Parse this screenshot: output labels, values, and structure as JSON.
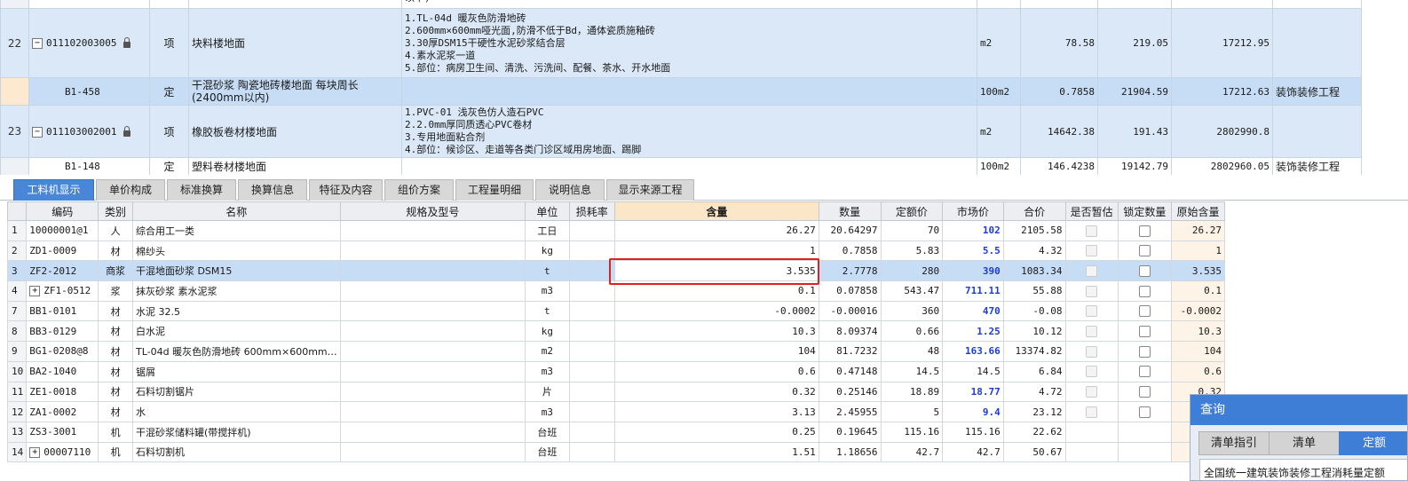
{
  "upper_rows": [
    {
      "kind": "partial",
      "feature": "以下)"
    },
    {
      "kind": "item",
      "num": "22",
      "code": "011102003005",
      "type": "项",
      "name": "块料楼地面",
      "features": [
        "1.TL-04d 暖灰色防滑地砖",
        "2.600mm×600mm哑光面,防滑不低于Bd，通体瓷质施釉砖",
        "3.30厚DSM15干硬性水泥砂浆结合层",
        "4.素水泥浆一道",
        "5.部位：病房卫生间、清洗、污洗间、配餐、茶水、开水地面"
      ],
      "unit": "m2",
      "qty": "78.58",
      "price": "219.05",
      "total": "17212.95",
      "profession": ""
    },
    {
      "kind": "sub",
      "num": "",
      "code": "B1-458",
      "type": "定",
      "name": "干混砂浆 陶瓷地砖楼地面 每块周长(2400mm以内)",
      "features": [],
      "unit": "100m2",
      "qty": "0.7858",
      "price": "21904.59",
      "total": "17212.63",
      "profession": "装饰装修工程"
    },
    {
      "kind": "item",
      "num": "23",
      "code": "011103002001",
      "type": "项",
      "name": "橡胶板卷材楼地面",
      "features": [
        "1.PVC-01 浅灰色仿人造石PVC",
        "2.2.0mm厚同质透心PVC卷材",
        "3.专用地面粘合剂",
        "4.部位：候诊区、走道等各类门诊区域用房地面、踢脚"
      ],
      "unit": "m2",
      "qty": "14642.38",
      "price": "191.43",
      "total": "2802990.8",
      "profession": ""
    },
    {
      "kind": "sub2",
      "num": "",
      "code": "B1-148",
      "type": "定",
      "name": "塑料卷材楼地面",
      "features": [],
      "unit": "100m2",
      "qty": "146.4238",
      "price": "19142.79",
      "total": "2802960.05",
      "profession": "装饰装修工程"
    }
  ],
  "tabs": [
    "工料机显示",
    "单价构成",
    "标准换算",
    "换算信息",
    "特征及内容",
    "组价方案",
    "工程量明细",
    "说明信息",
    "显示来源工程"
  ],
  "columns": [
    "编码",
    "类别",
    "名称",
    "规格及型号",
    "单位",
    "损耗率",
    "含量",
    "数量",
    "定额价",
    "市场价",
    "合价",
    "是否暂估",
    "锁定数量",
    "原始含量"
  ],
  "rows": [
    {
      "num": "1",
      "code": "10000001@1",
      "type": "人",
      "name": "综合用工一类",
      "spec": "",
      "unit": "工日",
      "loss": "",
      "content": "26.27",
      "qty": "20.64297",
      "quota": "70",
      "market": "102",
      "total": "2105.58",
      "est": false,
      "lock": true,
      "orig": "26.27",
      "exp": false
    },
    {
      "num": "2",
      "code": "ZD1-0009",
      "type": "材",
      "name": "棉纱头",
      "spec": "",
      "unit": "kg",
      "loss": "",
      "content": "1",
      "qty": "0.7858",
      "quota": "5.83",
      "market": "5.5",
      "total": "4.32",
      "est": false,
      "lock": true,
      "orig": "1",
      "exp": false
    },
    {
      "num": "3",
      "code": "ZF2-2012",
      "type": "商浆",
      "name": "干混地面砂浆 DSM15",
      "spec": "",
      "unit": "t",
      "loss": "",
      "content": "3.535",
      "qty": "2.7778",
      "quota": "280",
      "market": "390",
      "total": "1083.34",
      "est": false,
      "lock": true,
      "orig": "3.535",
      "exp": false,
      "selected": true
    },
    {
      "num": "4",
      "code": "ZF1-0512",
      "type": "浆",
      "name": "抹灰砂浆 素水泥浆",
      "spec": "",
      "unit": "m3",
      "loss": "",
      "content": "0.1",
      "qty": "0.07858",
      "quota": "543.47",
      "market": "711.11",
      "total": "55.88",
      "est": false,
      "lock": true,
      "orig": "0.1",
      "exp": true
    },
    {
      "num": "7",
      "code": "BB1-0101",
      "type": "材",
      "name": "水泥 32.5",
      "spec": "",
      "unit": "t",
      "loss": "",
      "content": "-0.0002",
      "qty": "-0.00016",
      "quota": "360",
      "market": "470",
      "total": "-0.08",
      "est": false,
      "lock": true,
      "orig": "-0.0002",
      "exp": false
    },
    {
      "num": "8",
      "code": "BB3-0129",
      "type": "材",
      "name": "白水泥",
      "spec": "",
      "unit": "kg",
      "loss": "",
      "content": "10.3",
      "qty": "8.09374",
      "quota": "0.66",
      "market": "1.25",
      "total": "10.12",
      "est": false,
      "lock": true,
      "orig": "10.3",
      "exp": false
    },
    {
      "num": "9",
      "code": "BG1-0208@8",
      "type": "材",
      "name": "TL-04d 暖灰色防滑地砖 600mm×600mm…",
      "spec": "",
      "unit": "m2",
      "loss": "",
      "content": "104",
      "qty": "81.7232",
      "quota": "48",
      "market": "163.66",
      "total": "13374.82",
      "est": false,
      "lock": true,
      "orig": "104",
      "exp": false
    },
    {
      "num": "10",
      "code": "BA2-1040",
      "type": "材",
      "name": "锯屑",
      "spec": "",
      "unit": "m3",
      "loss": "",
      "content": "0.6",
      "qty": "0.47148",
      "quota": "14.5",
      "market": "14.5",
      "total": "6.84",
      "est": false,
      "lock": true,
      "orig": "0.6",
      "exp": false
    },
    {
      "num": "11",
      "code": "ZE1-0018",
      "type": "材",
      "name": "石料切割锯片",
      "spec": "",
      "unit": "片",
      "loss": "",
      "content": "0.32",
      "qty": "0.25146",
      "quota": "18.89",
      "market": "18.77",
      "total": "4.72",
      "est": false,
      "lock": true,
      "orig": "0.32",
      "exp": false
    },
    {
      "num": "12",
      "code": "ZA1-0002",
      "type": "材",
      "name": "水",
      "spec": "",
      "unit": "m3",
      "loss": "",
      "content": "3.13",
      "qty": "2.45955",
      "quota": "5",
      "market": "9.4",
      "total": "23.12",
      "est": false,
      "lock": true,
      "orig": "",
      "exp": false
    },
    {
      "num": "13",
      "code": "ZS3-3001",
      "type": "机",
      "name": "干混砂浆储料罐(带搅拌机)",
      "spec": "",
      "unit": "台班",
      "loss": "",
      "content": "0.25",
      "qty": "0.19645",
      "quota": "115.16",
      "market": "115.16",
      "total": "22.62",
      "est": false,
      "lock": false,
      "orig": "",
      "exp": false
    },
    {
      "num": "14",
      "code": "00007110",
      "type": "机",
      "name": "石料切割机",
      "spec": "",
      "unit": "台班",
      "loss": "",
      "content": "1.51",
      "qty": "1.18656",
      "quota": "42.7",
      "market": "42.7",
      "total": "50.67",
      "est": false,
      "lock": false,
      "orig": "",
      "exp": true
    }
  ],
  "bold_market_rows": [
    "1",
    "2",
    "3",
    "4",
    "7",
    "8",
    "9",
    "11",
    "12"
  ],
  "dialog": {
    "title": "查询",
    "tabs": [
      "清单指引",
      "清单",
      "定额"
    ],
    "active_tab": "定额",
    "text": "全国统一建筑装饰装修工程消耗量定额"
  },
  "colors": {
    "accent": "#4a86d8",
    "selection": "#c7dcf5",
    "highlight_box": "#e0201a",
    "market_price": "#1b3cd8"
  }
}
